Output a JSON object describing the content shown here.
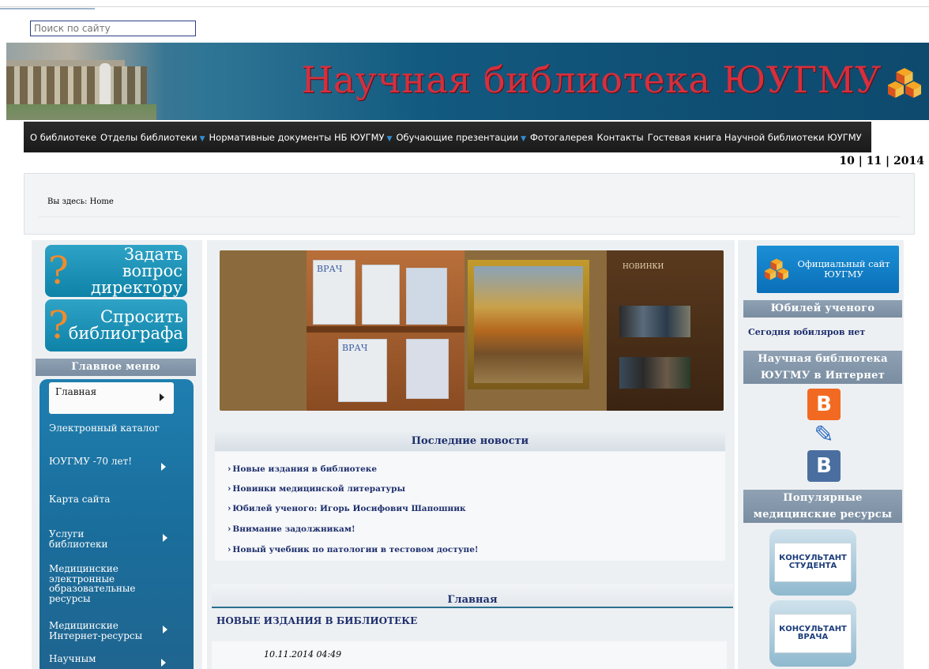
{
  "search": {
    "placeholder": "Поиск по сайту"
  },
  "header": {
    "title": "Научная библиотека ЮУГМУ"
  },
  "nav": [
    {
      "label": "О библиотеке",
      "has_dropdown": false
    },
    {
      "label": "Отделы библиотеки",
      "has_dropdown": true
    },
    {
      "label": "Нормативные документы НБ ЮУГМУ",
      "has_dropdown": true
    },
    {
      "label": "Обучающие презентации",
      "has_dropdown": true
    },
    {
      "label": "Фотогалерея",
      "has_dropdown": false
    },
    {
      "label": "Контакты",
      "has_dropdown": false
    },
    {
      "label": "Гостевая книга Научной библиотеки ЮУГМУ",
      "has_dropdown": false
    }
  ],
  "date": "10 | 11 | 2014",
  "breadcrumb": "Вы здесь: Home",
  "left": {
    "ask_director": "Задать вопрос директору",
    "ask_bibliographer": "Спросить библиографа",
    "main_menu_title": "Главное меню",
    "menu": [
      {
        "label": "Главная",
        "active": true,
        "arrow": true
      },
      {
        "label": "Электронный каталог",
        "arrow": false
      },
      {
        "label": "ЮУГМУ -70 лет!",
        "arrow": true
      },
      {
        "label": "Карта сайта",
        "arrow": false
      },
      {
        "label": "Услуги библиотеки",
        "arrow": true
      },
      {
        "label": "Медицинские электронные образовательные ресурсы",
        "arrow": false
      },
      {
        "label": "Медицинские Интернет-ресурсы",
        "arrow": true
      },
      {
        "label": "Научным",
        "arrow": true
      }
    ]
  },
  "center": {
    "slider_labels": [
      "ВРАЧ",
      "ВРАЧ",
      "НОВИНКИ"
    ],
    "news_title": "Последние новости",
    "news": [
      "Новые издания в библиотеке",
      "Новинки медицинской литературы",
      "Юбилей ученого: Игорь Иосифович Шапошник",
      "Внимание задолжникам!",
      "Новый учебник по патологии в тестовом доступе!"
    ],
    "main_title": "Главная",
    "article_title": "НОВЫЕ ИЗДАНИЯ В БИБЛИОТЕКЕ",
    "article_date": "10.11.2014 04:49"
  },
  "right": {
    "official_site": "Официальный сайт ЮУГМУ",
    "jubilee_title": "Юбилей ученого",
    "jubilee_text": "Сегодня юбиляров нет",
    "internet_title": "Научная библиотека ЮУГМУ в Интернет",
    "social": [
      {
        "icon": "blogger-icon",
        "glyph": "B",
        "color": "#f26a21"
      },
      {
        "icon": "livejournal-icon",
        "glyph": "✎",
        "color": "#2d6cc0"
      },
      {
        "icon": "vk-icon",
        "glyph": "В",
        "color": "#4a6ea0"
      }
    ],
    "popular_title": "Популярные медицинские ресурсы",
    "resources": [
      "КОНСУЛЬТАНТ СТУДЕНТА",
      "КОНСУЛЬТАНТ ВРАЧА"
    ]
  }
}
